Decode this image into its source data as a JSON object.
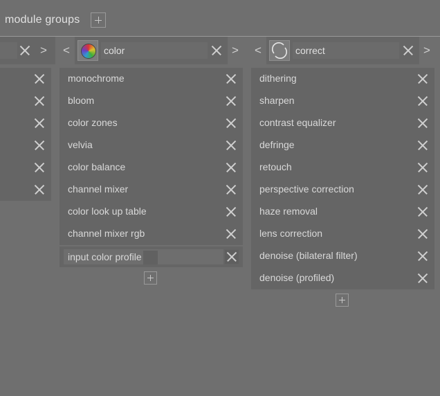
{
  "header": {
    "title": "module groups"
  },
  "columns": [
    {
      "id": "left-partial",
      "group_name": "",
      "items": [
        "",
        "",
        "",
        "",
        "",
        ""
      ]
    },
    {
      "id": "color",
      "group_name": "color",
      "prev": "<",
      "next": ">",
      "items": [
        "monochrome",
        "bloom",
        "color zones",
        "velvia",
        "color balance",
        "channel mixer",
        "color look up table",
        "channel mixer rgb"
      ],
      "add_field_value": "input color profile"
    },
    {
      "id": "correct",
      "group_name": "correct",
      "prev": "<",
      "next": ">",
      "items": [
        "dithering",
        "sharpen",
        "contrast equalizer",
        "defringe",
        "retouch",
        "perspective correction",
        "haze removal",
        "lens correction",
        "denoise (bilateral filter)",
        "denoise (profiled)"
      ]
    }
  ],
  "icons": {
    "remove": "close-icon",
    "add": "plus-icon",
    "color_group": "color-wheel-icon",
    "correct_group": "circle-arrows-icon"
  },
  "colors": {
    "background": "#6f6f6f",
    "panel": "#656565",
    "text": "#d9d9d9"
  }
}
